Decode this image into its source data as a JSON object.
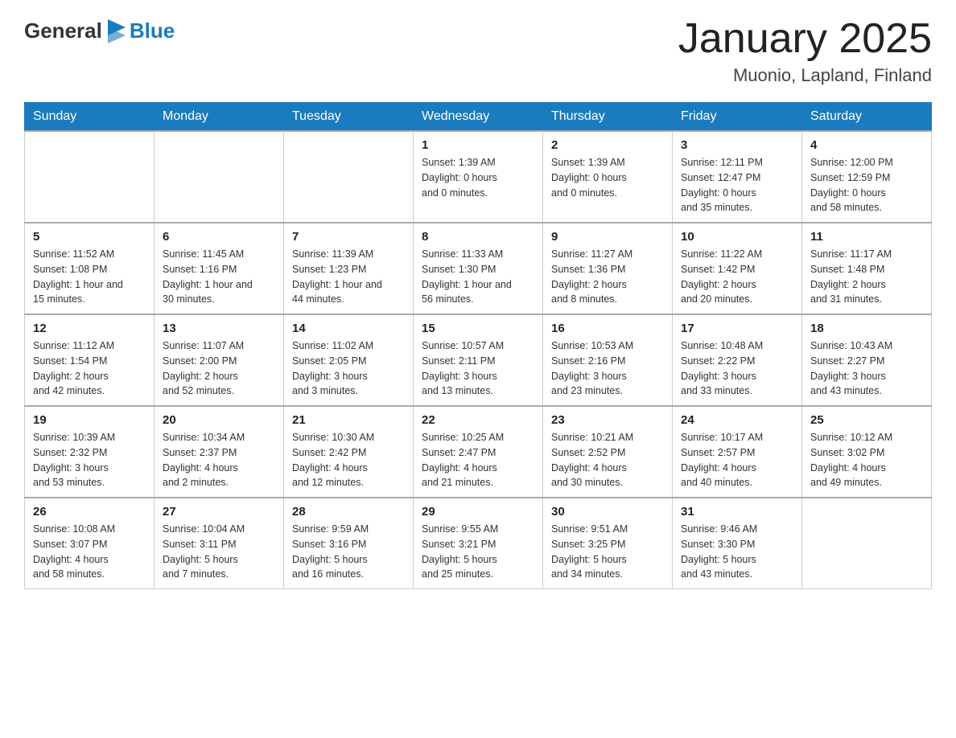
{
  "header": {
    "logo": {
      "general": "General",
      "flag_icon": "▶",
      "blue": "Blue"
    },
    "title": "January 2025",
    "location": "Muonio, Lapland, Finland"
  },
  "days_of_week": [
    "Sunday",
    "Monday",
    "Tuesday",
    "Wednesday",
    "Thursday",
    "Friday",
    "Saturday"
  ],
  "weeks": [
    [
      {
        "day": "",
        "info": ""
      },
      {
        "day": "",
        "info": ""
      },
      {
        "day": "",
        "info": ""
      },
      {
        "day": "1",
        "info": "Sunset: 1:39 AM\nDaylight: 0 hours\nand 0 minutes."
      },
      {
        "day": "2",
        "info": "Sunset: 1:39 AM\nDaylight: 0 hours\nand 0 minutes."
      },
      {
        "day": "3",
        "info": "Sunrise: 12:11 PM\nSunset: 12:47 PM\nDaylight: 0 hours\nand 35 minutes."
      },
      {
        "day": "4",
        "info": "Sunrise: 12:00 PM\nSunset: 12:59 PM\nDaylight: 0 hours\nand 58 minutes."
      }
    ],
    [
      {
        "day": "5",
        "info": "Sunrise: 11:52 AM\nSunset: 1:08 PM\nDaylight: 1 hour and\n15 minutes."
      },
      {
        "day": "6",
        "info": "Sunrise: 11:45 AM\nSunset: 1:16 PM\nDaylight: 1 hour and\n30 minutes."
      },
      {
        "day": "7",
        "info": "Sunrise: 11:39 AM\nSunset: 1:23 PM\nDaylight: 1 hour and\n44 minutes."
      },
      {
        "day": "8",
        "info": "Sunrise: 11:33 AM\nSunset: 1:30 PM\nDaylight: 1 hour and\n56 minutes."
      },
      {
        "day": "9",
        "info": "Sunrise: 11:27 AM\nSunset: 1:36 PM\nDaylight: 2 hours\nand 8 minutes."
      },
      {
        "day": "10",
        "info": "Sunrise: 11:22 AM\nSunset: 1:42 PM\nDaylight: 2 hours\nand 20 minutes."
      },
      {
        "day": "11",
        "info": "Sunrise: 11:17 AM\nSunset: 1:48 PM\nDaylight: 2 hours\nand 31 minutes."
      }
    ],
    [
      {
        "day": "12",
        "info": "Sunrise: 11:12 AM\nSunset: 1:54 PM\nDaylight: 2 hours\nand 42 minutes."
      },
      {
        "day": "13",
        "info": "Sunrise: 11:07 AM\nSunset: 2:00 PM\nDaylight: 2 hours\nand 52 minutes."
      },
      {
        "day": "14",
        "info": "Sunrise: 11:02 AM\nSunset: 2:05 PM\nDaylight: 3 hours\nand 3 minutes."
      },
      {
        "day": "15",
        "info": "Sunrise: 10:57 AM\nSunset: 2:11 PM\nDaylight: 3 hours\nand 13 minutes."
      },
      {
        "day": "16",
        "info": "Sunrise: 10:53 AM\nSunset: 2:16 PM\nDaylight: 3 hours\nand 23 minutes."
      },
      {
        "day": "17",
        "info": "Sunrise: 10:48 AM\nSunset: 2:22 PM\nDaylight: 3 hours\nand 33 minutes."
      },
      {
        "day": "18",
        "info": "Sunrise: 10:43 AM\nSunset: 2:27 PM\nDaylight: 3 hours\nand 43 minutes."
      }
    ],
    [
      {
        "day": "19",
        "info": "Sunrise: 10:39 AM\nSunset: 2:32 PM\nDaylight: 3 hours\nand 53 minutes."
      },
      {
        "day": "20",
        "info": "Sunrise: 10:34 AM\nSunset: 2:37 PM\nDaylight: 4 hours\nand 2 minutes."
      },
      {
        "day": "21",
        "info": "Sunrise: 10:30 AM\nSunset: 2:42 PM\nDaylight: 4 hours\nand 12 minutes."
      },
      {
        "day": "22",
        "info": "Sunrise: 10:25 AM\nSunset: 2:47 PM\nDaylight: 4 hours\nand 21 minutes."
      },
      {
        "day": "23",
        "info": "Sunrise: 10:21 AM\nSunset: 2:52 PM\nDaylight: 4 hours\nand 30 minutes."
      },
      {
        "day": "24",
        "info": "Sunrise: 10:17 AM\nSunset: 2:57 PM\nDaylight: 4 hours\nand 40 minutes."
      },
      {
        "day": "25",
        "info": "Sunrise: 10:12 AM\nSunset: 3:02 PM\nDaylight: 4 hours\nand 49 minutes."
      }
    ],
    [
      {
        "day": "26",
        "info": "Sunrise: 10:08 AM\nSunset: 3:07 PM\nDaylight: 4 hours\nand 58 minutes."
      },
      {
        "day": "27",
        "info": "Sunrise: 10:04 AM\nSunset: 3:11 PM\nDaylight: 5 hours\nand 7 minutes."
      },
      {
        "day": "28",
        "info": "Sunrise: 9:59 AM\nSunset: 3:16 PM\nDaylight: 5 hours\nand 16 minutes."
      },
      {
        "day": "29",
        "info": "Sunrise: 9:55 AM\nSunset: 3:21 PM\nDaylight: 5 hours\nand 25 minutes."
      },
      {
        "day": "30",
        "info": "Sunrise: 9:51 AM\nSunset: 3:25 PM\nDaylight: 5 hours\nand 34 minutes."
      },
      {
        "day": "31",
        "info": "Sunrise: 9:46 AM\nSunset: 3:30 PM\nDaylight: 5 hours\nand 43 minutes."
      },
      {
        "day": "",
        "info": ""
      }
    ]
  ]
}
